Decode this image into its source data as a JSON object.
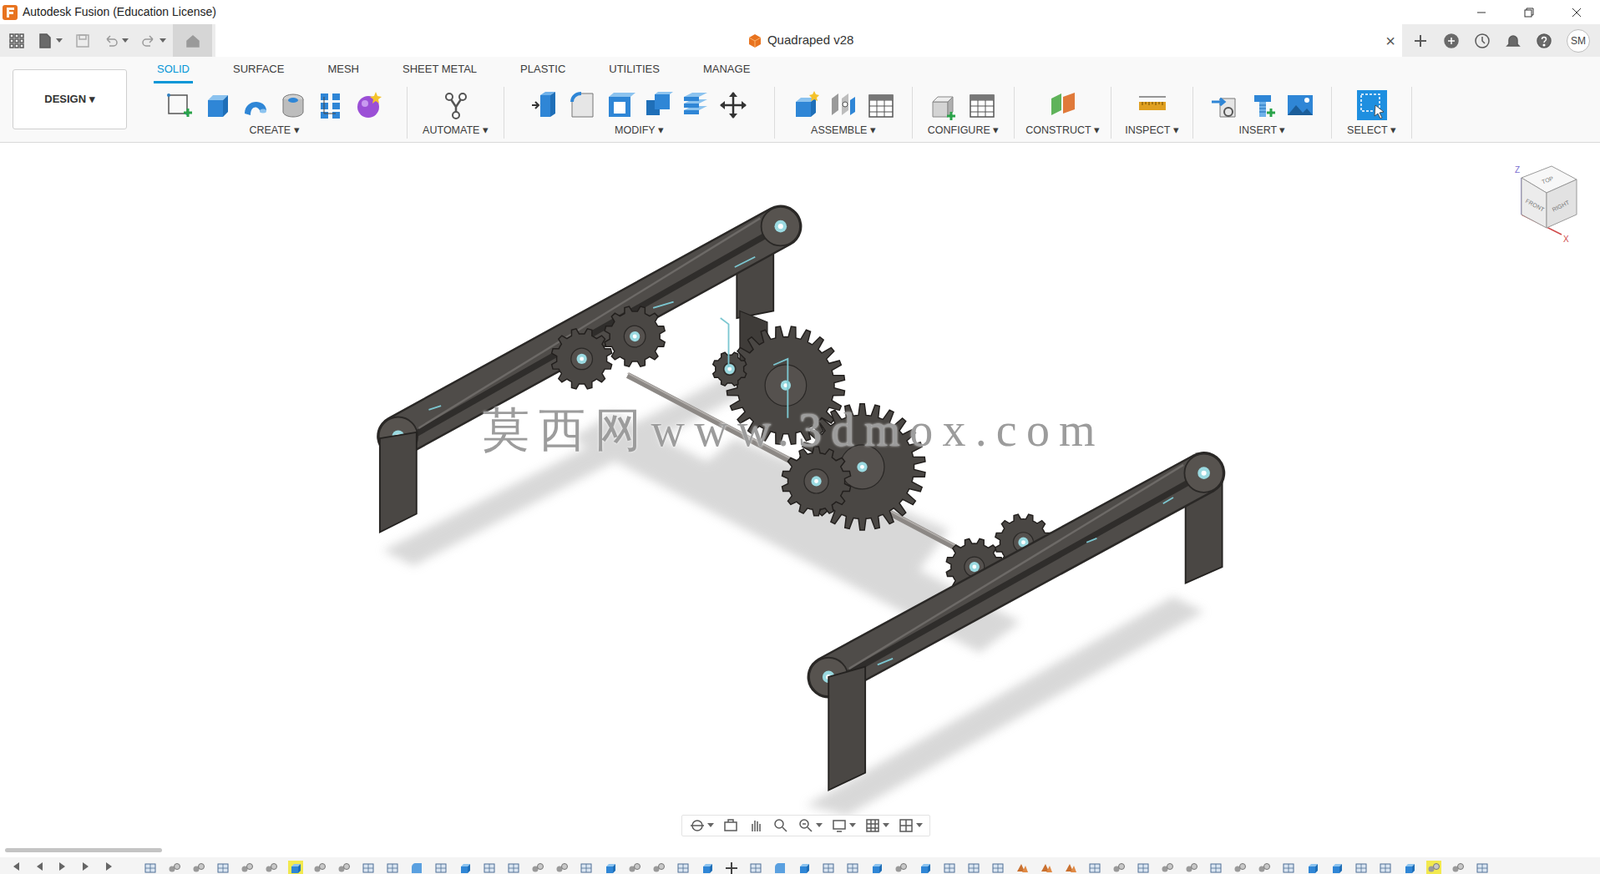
{
  "window": {
    "title": "Autodesk Fusion (Education License)"
  },
  "document_tab": {
    "title": "Quadraped v28",
    "close": "×"
  },
  "user": {
    "initials": "SM"
  },
  "workspace": {
    "label": "DESIGN ▾"
  },
  "toolbar_tabs": [
    {
      "label": "SOLID",
      "selected": true
    },
    {
      "label": "SURFACE",
      "selected": false
    },
    {
      "label": "MESH",
      "selected": false
    },
    {
      "label": "SHEET METAL",
      "selected": false
    },
    {
      "label": "PLASTIC",
      "selected": false
    },
    {
      "label": "UTILITIES",
      "selected": false
    },
    {
      "label": "MANAGE",
      "selected": false
    }
  ],
  "toolbar_groups": [
    {
      "label": "CREATE ▾"
    },
    {
      "label": "AUTOMATE ▾"
    },
    {
      "label": "MODIFY ▾"
    },
    {
      "label": "ASSEMBLE ▾"
    },
    {
      "label": "CONFIGURE ▾"
    },
    {
      "label": "CONSTRUCT ▾"
    },
    {
      "label": "INSPECT ▾"
    },
    {
      "label": "INSERT ▾"
    },
    {
      "label": "SELECT ▾"
    }
  ],
  "viewcube": {
    "faces": [
      "TOP",
      "FRONT",
      "RIGHT"
    ],
    "axes": [
      "Z",
      "X"
    ]
  },
  "watermark": "莫西网www.3dmox.com",
  "timeline": {
    "items": [
      {
        "kind": "sketch",
        "selected": false
      },
      {
        "kind": "joint",
        "selected": false
      },
      {
        "kind": "joint",
        "selected": false
      },
      {
        "kind": "sketch",
        "selected": false
      },
      {
        "kind": "joint",
        "selected": false
      },
      {
        "kind": "joint",
        "selected": false
      },
      {
        "kind": "extrude",
        "selected": true
      },
      {
        "kind": "joint",
        "selected": false
      },
      {
        "kind": "joint",
        "selected": false
      },
      {
        "kind": "sketch",
        "selected": false
      },
      {
        "kind": "sketch",
        "selected": false
      },
      {
        "kind": "fillet",
        "selected": false
      },
      {
        "kind": "sketch",
        "selected": false
      },
      {
        "kind": "extrude",
        "selected": false
      },
      {
        "kind": "sketch",
        "selected": false
      },
      {
        "kind": "sketch",
        "selected": false
      },
      {
        "kind": "joint",
        "selected": false
      },
      {
        "kind": "joint",
        "selected": false
      },
      {
        "kind": "sketch",
        "selected": false
      },
      {
        "kind": "extrude",
        "selected": false
      },
      {
        "kind": "joint",
        "selected": false
      },
      {
        "kind": "joint",
        "selected": false
      },
      {
        "kind": "sketch",
        "selected": false
      },
      {
        "kind": "extrude",
        "selected": false
      },
      {
        "kind": "move",
        "selected": false
      },
      {
        "kind": "sketch",
        "selected": false
      },
      {
        "kind": "fillet",
        "selected": false
      },
      {
        "kind": "extrude",
        "selected": false
      },
      {
        "kind": "sketch",
        "selected": false
      },
      {
        "kind": "sketch",
        "selected": false
      },
      {
        "kind": "extrude",
        "selected": false
      },
      {
        "kind": "joint",
        "selected": false
      },
      {
        "kind": "extrude",
        "selected": false
      },
      {
        "kind": "sketch",
        "selected": false
      },
      {
        "kind": "sketch",
        "selected": false
      },
      {
        "kind": "sketch",
        "selected": false
      },
      {
        "kind": "component",
        "selected": false
      },
      {
        "kind": "component",
        "selected": false
      },
      {
        "kind": "component",
        "selected": false
      },
      {
        "kind": "sketch",
        "selected": false
      },
      {
        "kind": "joint",
        "selected": false
      },
      {
        "kind": "sketch",
        "selected": false
      },
      {
        "kind": "joint",
        "selected": false
      },
      {
        "kind": "joint",
        "selected": false
      },
      {
        "kind": "sketch",
        "selected": false
      },
      {
        "kind": "joint",
        "selected": false
      },
      {
        "kind": "joint",
        "selected": false
      },
      {
        "kind": "sketch",
        "selected": false
      },
      {
        "kind": "extrude",
        "selected": false
      },
      {
        "kind": "extrude",
        "selected": false
      },
      {
        "kind": "sketch",
        "selected": false
      },
      {
        "kind": "sketch",
        "selected": false
      },
      {
        "kind": "extrude",
        "selected": false
      },
      {
        "kind": "joint",
        "selected": true
      },
      {
        "kind": "joint",
        "selected": false
      },
      {
        "kind": "sketch",
        "selected": false
      }
    ]
  }
}
